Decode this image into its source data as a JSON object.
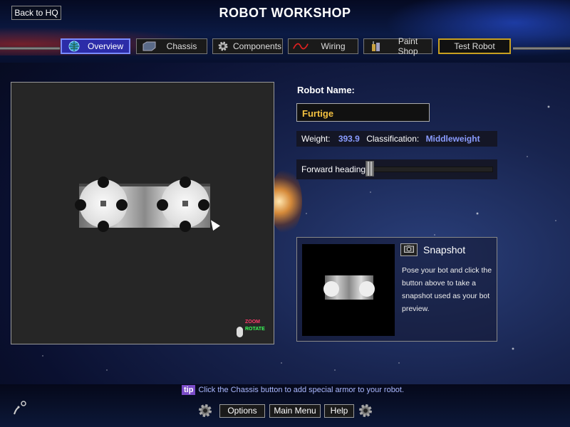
{
  "header": {
    "title": "ROBOT WORKSHOP",
    "back_button": "Back to HQ"
  },
  "tabs": [
    {
      "label": "Overview",
      "icon": "globe-icon",
      "active": true
    },
    {
      "label": "Chassis",
      "icon": "chassis-icon",
      "active": false
    },
    {
      "label": "Components",
      "icon": "gear-icon",
      "active": false
    },
    {
      "label": "Wiring",
      "icon": "wire-icon",
      "active": false
    },
    {
      "label": "Paint Shop",
      "icon": "paint-cans-icon",
      "active": false
    },
    {
      "label": "Test Robot",
      "icon": "",
      "active": false
    }
  ],
  "viewport": {
    "hint_zoom": "ZOOM",
    "hint_rotate": "ROTATE"
  },
  "robot": {
    "name_label": "Robot Name:",
    "name": "Furtige",
    "weight_label": "Weight:",
    "weight": "393.9",
    "class_label": "Classification:",
    "classification": "Middleweight",
    "heading_label": "Forward heading:",
    "heading_value": 0
  },
  "snapshot": {
    "label": "Snapshot",
    "description": "Pose your bot and click the button above to take a snapshot used as your bot preview."
  },
  "footer": {
    "tip_badge": "tip",
    "tip_text": "Click the Chassis button to add special armor to your robot.",
    "options": "Options",
    "main_menu": "Main Menu",
    "help": "Help"
  },
  "colors": {
    "accent_value": "#8a9cff",
    "robot_name": "#f2c040",
    "active_tab": "#2c2ca8",
    "test_border": "#c8a020"
  }
}
